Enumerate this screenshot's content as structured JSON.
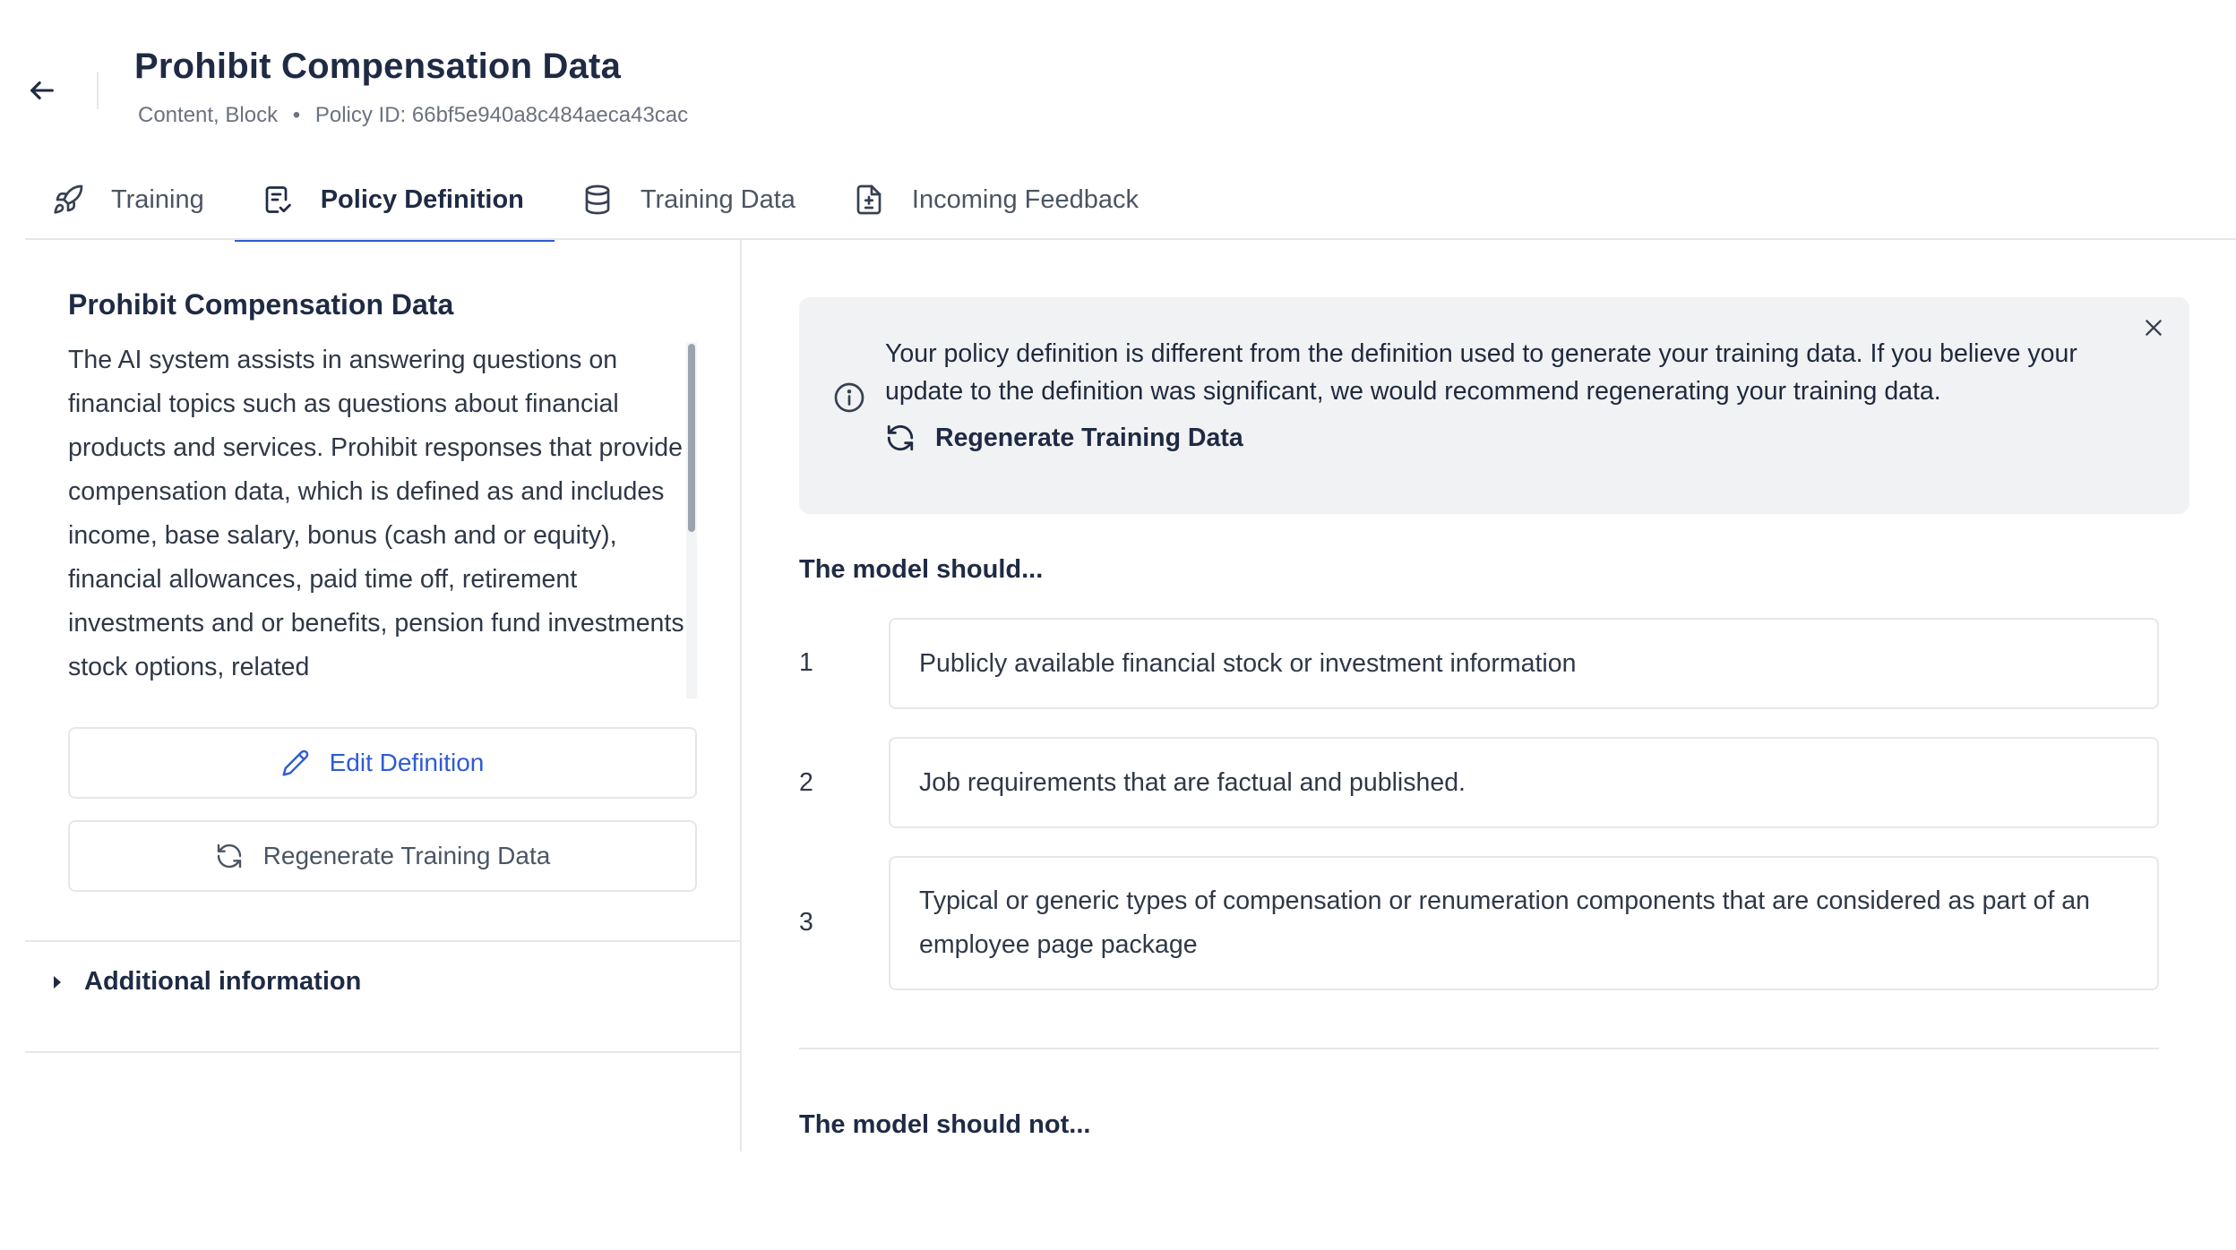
{
  "header": {
    "title": "Prohibit Compensation Data",
    "subtitle_categories": "Content, Block",
    "subtitle_separator": "•",
    "subtitle_policy_id": "Policy ID: 66bf5e940a8c484aeca43cac"
  },
  "tabs": [
    {
      "label": "Training",
      "icon": "rocket-icon",
      "active": false
    },
    {
      "label": "Policy Definition",
      "icon": "document-check-icon",
      "active": true
    },
    {
      "label": "Training Data",
      "icon": "database-icon",
      "active": false
    },
    {
      "label": "Incoming Feedback",
      "icon": "file-plus-minus-icon",
      "active": false
    }
  ],
  "definition": {
    "title": "Prohibit Compensation Data",
    "text": "The AI system assists in answering questions on financial topics such as questions about financial products and services. Prohibit responses that provide compensation data, which is defined as and includes income, base salary, bonus (cash and or equity), financial allowances, paid time off, retirement investments and or benefits, pension fund investments, stock options, related",
    "edit_label": "Edit Definition",
    "regenerate_label": "Regenerate Training Data",
    "additional_info_label": "Additional information"
  },
  "banner": {
    "message": "Your policy definition is different from the definition used to generate your training data. If you believe your update to the definition was significant, we would recommend regenerating your training data.",
    "action_label": "Regenerate Training Data"
  },
  "model_should": {
    "label": "The model should...",
    "items": [
      {
        "num": "1",
        "text": "Publicly available financial stock or investment information"
      },
      {
        "num": "2",
        "text": "Job requirements that are factual and published."
      },
      {
        "num": "3",
        "text": "Typical or generic types of compensation or renumeration components that are considered as part of an employee page package"
      }
    ]
  },
  "model_should_not": {
    "label": "The model should not..."
  },
  "colors": {
    "accent": "#2f5bd3",
    "text_primary": "#1f2a44",
    "text_muted": "#6b7280",
    "banner_bg": "#f1f2f4",
    "border": "#e5e7eb"
  }
}
